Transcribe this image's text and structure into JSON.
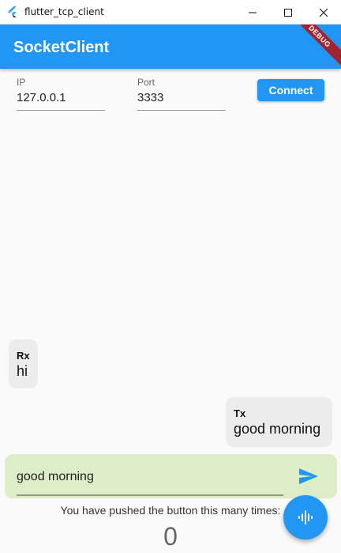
{
  "window": {
    "title": "flutter_tcp_client",
    "icons": {
      "app": "flutter-logo-icon",
      "minimize": "minimize-icon",
      "maximize": "maximize-icon",
      "close": "close-icon"
    }
  },
  "appbar": {
    "title": "SocketClient",
    "debug_banner": "DEBUG",
    "color": "#2196f3"
  },
  "form": {
    "ip": {
      "label": "IP",
      "value": "127.0.0.1"
    },
    "port": {
      "label": "Port",
      "value": "3333"
    },
    "connect_label": "Connect"
  },
  "messages": [
    {
      "sender": "Rx",
      "text": "hi"
    },
    {
      "sender": "Tx",
      "text": "good morning"
    }
  ],
  "compose": {
    "value": "good morning",
    "send_icon": "send-icon",
    "background": "#dcedc8"
  },
  "counter": {
    "label": "You have pushed the button this many times:",
    "value": "0"
  },
  "fab": {
    "icon": "voice-wave-icon"
  }
}
